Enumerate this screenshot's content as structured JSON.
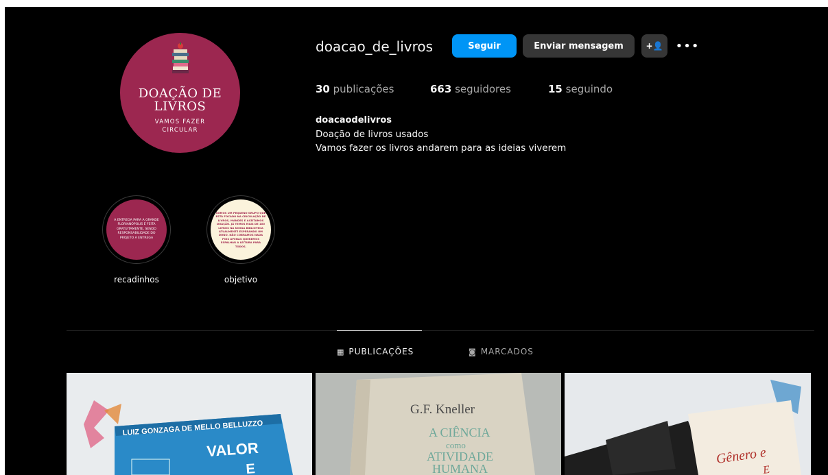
{
  "profile": {
    "username": "doacao_de_livros",
    "follow_label": "Seguir",
    "message_label": "Enviar mensagem",
    "add_person_icon": "+👤",
    "more_icon": "•••",
    "stats": {
      "posts_count": "30",
      "posts_label": "publicações",
      "followers_count": "663",
      "followers_label": "seguidores",
      "following_count": "15",
      "following_label": "seguindo"
    },
    "bio": {
      "name": "doacaodelivros",
      "line1": "Doação de livros usados",
      "line2": "Vamos fazer os livros andarem para as ideias viverem"
    }
  },
  "avatar": {
    "title_line1": "DOAÇÃO DE",
    "title_line2": "LIVROS",
    "subtitle_line1": "VAMOS FAZER",
    "subtitle_line2": "CIRCULAR"
  },
  "highlights": [
    {
      "label": "recadinhos",
      "cover_text": "A ENTREGA PARA A GRANDE FLORIANÓPOLIS É FEITA GRATUITAMENTE, SENDO RESPONSABILIDADE DO PROJETO A ENTREGA"
    },
    {
      "label": "objetivo",
      "cover_text": "SOMOS UM PEQUENO GRUPO QUE ESTÁ FOCADO NA CIRCULAÇÃO DE LIVROS, MANDES E ACEITAMOS DOAÇÃO. JÁ TEMOS MAIS DE 100 LIVROS NA NOSSA BIBLIOTECA ATUALMENTE ESPERANDO UM DONO. NÃO COBRAMOS NADA POIS APENAS QUEREMOS ESPALHAR A LEITURA PARA TODOS."
    }
  ],
  "tabs": {
    "posts_label": "PUBLICAÇÕES",
    "posts_icon": "▦",
    "tagged_label": "MARCADOS",
    "tagged_icon": "◙"
  },
  "posts": [
    {
      "book_author": "LUIZ GONZAGA DE MELLO BELLUZZO",
      "book_title": "VALOR",
      "book_title_2": "E"
    },
    {
      "book_author": "G.F. Kneller",
      "book_title_l1": "A CIÊNCIA",
      "book_title_l2": "como",
      "book_title_l3": "ATIVIDADE",
      "book_title_l4": "HUMANA"
    },
    {
      "book_title": "Gênero e",
      "book_title_2": "E"
    }
  ],
  "colors": {
    "background": "#000000",
    "brand_magenta": "#9c2750",
    "follow_blue": "#0095f6",
    "secondary_button": "#363636",
    "muted_text": "#a8a8a8"
  }
}
